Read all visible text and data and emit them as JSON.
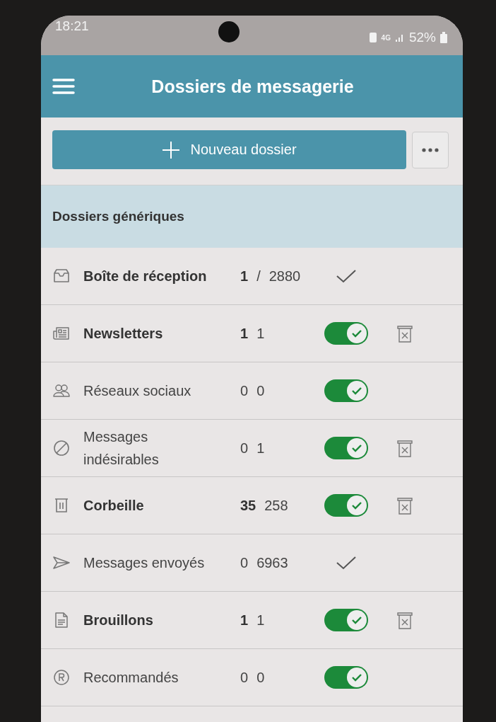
{
  "status_bar": {
    "time": "18:21",
    "network": "4G",
    "battery": "52%"
  },
  "app_bar": {
    "title": "Dossiers de messagerie"
  },
  "new_folder_button": {
    "label": "Nouveau dossier"
  },
  "section": {
    "title": "Dossiers génériques"
  },
  "folders": [
    {
      "name": "Boîte de réception",
      "unread": "1",
      "separator": "/",
      "total": "2880",
      "unread_highlight": true,
      "kind": "check",
      "deletable": false
    },
    {
      "name": "Newsletters",
      "unread": "1",
      "total": "1",
      "unread_highlight": true,
      "kind": "toggle",
      "on": true,
      "deletable": true
    },
    {
      "name": "Réseaux sociaux",
      "unread": "0",
      "total": "0",
      "unread_highlight": false,
      "kind": "toggle",
      "on": true,
      "deletable": false
    },
    {
      "name": "Messages indésirables",
      "unread": "0",
      "total": "1",
      "unread_highlight": false,
      "kind": "toggle",
      "on": true,
      "deletable": true
    },
    {
      "name": "Corbeille",
      "unread": "35",
      "total": "258",
      "unread_highlight": true,
      "kind": "toggle",
      "on": true,
      "deletable": true
    },
    {
      "name": "Messages envoyés",
      "unread": "0",
      "total": "6963",
      "unread_highlight": false,
      "kind": "check",
      "deletable": false
    },
    {
      "name": "Brouillons",
      "unread": "1",
      "total": "1",
      "unread_highlight": true,
      "kind": "toggle",
      "on": true,
      "deletable": true
    },
    {
      "name": "Recommandés",
      "unread": "0",
      "total": "0",
      "unread_highlight": false,
      "kind": "toggle",
      "on": true,
      "deletable": false
    }
  ]
}
